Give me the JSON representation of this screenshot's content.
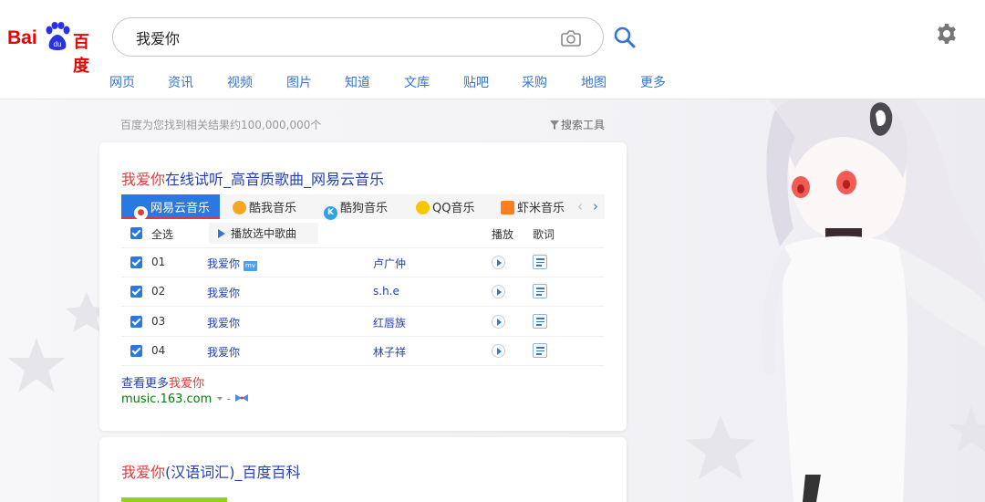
{
  "header": {
    "logo": {
      "bai": "Bai",
      "du": "du",
      "cn": "百度"
    },
    "search_value": "我爱你",
    "nav": [
      "网页",
      "资讯",
      "视频",
      "图片",
      "知道",
      "文库",
      "贴吧",
      "采购",
      "地图",
      "更多"
    ]
  },
  "results": {
    "stats": "百度为您找到相关结果约100,000,000个",
    "tools": "搜索工具"
  },
  "music_card": {
    "title_em": "我爱你",
    "title_rest": "在线试听_高音质歌曲_网易云音乐",
    "tabs": [
      {
        "label": "网易云音乐",
        "active": true,
        "icon_color": "#e4393c",
        "icon": "网易云"
      },
      {
        "label": "酷我音乐",
        "active": false,
        "icon_color": "#f5a623",
        "icon": "酷我"
      },
      {
        "label": "酷狗音乐",
        "active": false,
        "icon_color": "#2aa3e8",
        "icon": "K"
      },
      {
        "label": "QQ音乐",
        "active": false,
        "icon_color": "#f7c600",
        "icon": "QQ"
      },
      {
        "label": "虾米音乐",
        "active": false,
        "icon_color": "#ff7f1e",
        "icon": "虾"
      }
    ],
    "header_row": {
      "select_all": "全选",
      "play_selected": "播放选中歌曲",
      "play": "播放",
      "lyrics": "歌词"
    },
    "songs": [
      {
        "num": "01",
        "title": "我爱你",
        "badge": "mv",
        "artist": "卢广仲"
      },
      {
        "num": "02",
        "title": "我爱你",
        "badge": "",
        "artist": "s.h.e"
      },
      {
        "num": "03",
        "title": "我爱你",
        "badge": "",
        "artist": "红唇族"
      },
      {
        "num": "04",
        "title": "我爱你",
        "badge": "",
        "artist": "林子祥"
      }
    ],
    "more_prefix": "查看更多",
    "more_em": "我爱你",
    "source": "music.163.com",
    "source_dash": "-"
  },
  "baike_card": {
    "title_em": "我爱你",
    "title_rest": "(汉语词汇)_百度百科"
  },
  "colors": {
    "link": "#2440b3",
    "highlight": "#e4393c",
    "accent": "#2979e3",
    "url_green": "#008000"
  }
}
